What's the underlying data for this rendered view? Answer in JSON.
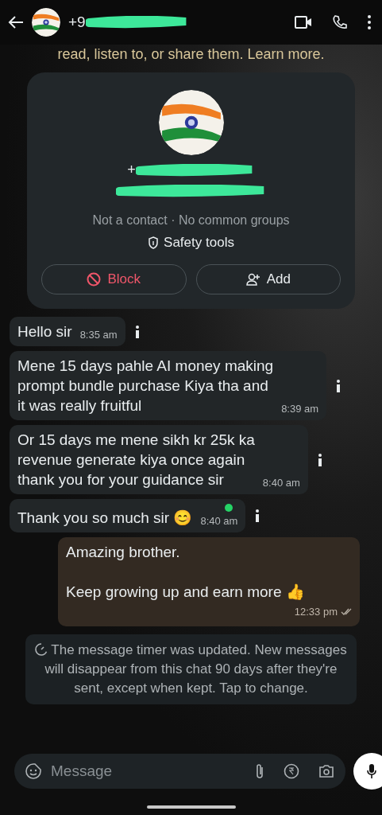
{
  "header": {
    "title": "+9"
  },
  "encryption_notice": {
    "text": "read, listen to, or share them. Learn more."
  },
  "contact_card": {
    "name_prefix": "+",
    "info": "Not a contact · No common groups",
    "safety_link": "Safety tools",
    "buttons": [
      {
        "label": "Block",
        "kind": "block"
      },
      {
        "label": "Add",
        "kind": "add"
      }
    ]
  },
  "messages": [
    {
      "kind": "incoming",
      "text": "Hello sir",
      "time": "8:35 am",
      "unread_dot": false
    },
    {
      "kind": "incoming",
      "text": "Mene 15 days pahle AI money making\nprompt bundle purchase Kiya tha and\nit was really fruitful",
      "time": "8:39 am",
      "unread_dot": false
    },
    {
      "kind": "incoming",
      "text": "Or 15 days me mene sikh kr 25k ka\nrevenue generate kiya once again\nthank you for your guidance sir",
      "time": "8:40 am",
      "unread_dot": false
    },
    {
      "kind": "incoming",
      "text": "Thank you so much sir 😊",
      "time": "8:40 am",
      "unread_dot": true
    },
    {
      "kind": "outgoing",
      "text": "Amazing brother.\n\nKeep growing up and earn more 👍",
      "time": "12:33 pm",
      "read": false
    }
  ],
  "system_notice": {
    "text": "The message timer was updated. New messages will disappear from this chat 90 days after they're sent, except when kept. Tap to change."
  },
  "composer": {
    "placeholder": "Message"
  }
}
